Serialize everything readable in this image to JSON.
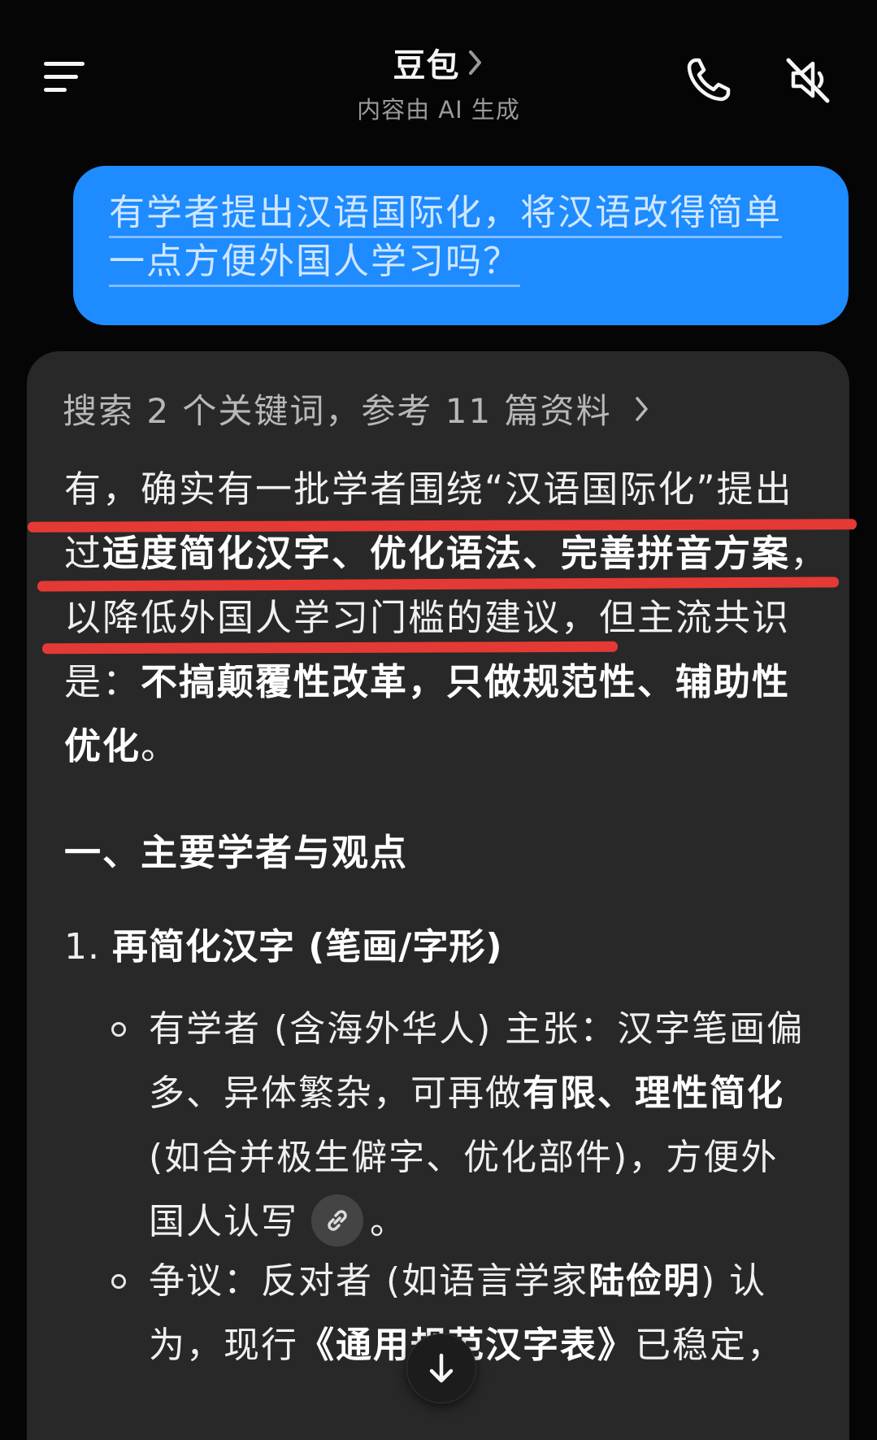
{
  "header": {
    "title": "豆包",
    "subtitle": "内容由 AI 生成",
    "icons": {
      "menu": "menu-icon",
      "title_chevron": "chevron-right-icon",
      "phone": "phone-icon",
      "mute": "speaker-muted-icon"
    }
  },
  "user_message": {
    "lines": [
      "有学者提出汉语国际化，将汉语改得简单",
      "一点方便外国人学习吗？"
    ]
  },
  "answer": {
    "search_summary": "搜索 2 个关键词，参考 11 篇资料",
    "intro": {
      "line1": "有，确实有一批学者围绕“汉语国际化”提出",
      "line2_a": "过",
      "line2_b": "适度简化汉字、优化语法、完善拼音方案",
      "line2_c": "，",
      "line3": "以降低外国人学习门槛的建议，但主流共识",
      "line4_a": "是：",
      "line4_b": "不搞颠覆性改革，只做规范性、辅助性",
      "line5_a": "优化",
      "line5_b": "。"
    },
    "section1_title": "一、主要学者与观点",
    "item1": {
      "number": "1.",
      "title": "再简化汉字 (笔画/字形)"
    },
    "bullet1": {
      "line1": "有学者 (含海外华人) 主张：汉字笔画偏",
      "line2_a": "多、异体繁杂，可再做",
      "line2_b": "有限、理性简化",
      "line3": "(如合并极生僻字、优化部件)，方便外",
      "line4_a": "国人认写",
      "line4_b": "。"
    },
    "bullet2": {
      "line1_a": "争议：反对者 (如语言学家",
      "line1_b": "陆俭明",
      "line1_c": ") 认",
      "line2_a": "为，现行",
      "line2_b": "《通用规范汉字表》",
      "line2_c": "已稳定，"
    }
  },
  "annotation_color": "#e53935",
  "accent_color": "#1e8bff"
}
